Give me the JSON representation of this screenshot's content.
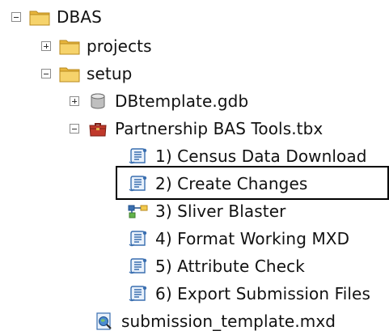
{
  "tree": {
    "root": {
      "label": "DBAS",
      "icon": "folder-icon",
      "expanded": true
    },
    "projects": {
      "label": "projects",
      "icon": "folder-icon",
      "expanded": false
    },
    "setup": {
      "label": "setup",
      "icon": "folder-icon",
      "expanded": true
    },
    "dbtemplate": {
      "label": "DBtemplate.gdb",
      "icon": "geodatabase-icon",
      "expanded": false
    },
    "toolbox": {
      "label": "Partnership BAS Tools.tbx",
      "icon": "toolbox-icon",
      "expanded": true
    },
    "tools": [
      {
        "label": "1) Census Data Download",
        "icon": "script-tool-icon"
      },
      {
        "label": "2) Create Changes",
        "icon": "script-tool-icon"
      },
      {
        "label": "3) Sliver Blaster",
        "icon": "model-tool-icon"
      },
      {
        "label": "4) Format Working MXD",
        "icon": "script-tool-icon"
      },
      {
        "label": "5) Attribute Check",
        "icon": "script-tool-icon"
      },
      {
        "label": "6) Export Submission Files",
        "icon": "script-tool-icon"
      }
    ],
    "mxd": {
      "label": "submission_template.mxd",
      "icon": "map-document-icon"
    }
  },
  "colors": {
    "folder": "#f2c94c",
    "folder_dark": "#c9972b",
    "toolbox": "#c0392b",
    "script_blue": "#3a6fb0",
    "highlight_border": "#000000"
  }
}
